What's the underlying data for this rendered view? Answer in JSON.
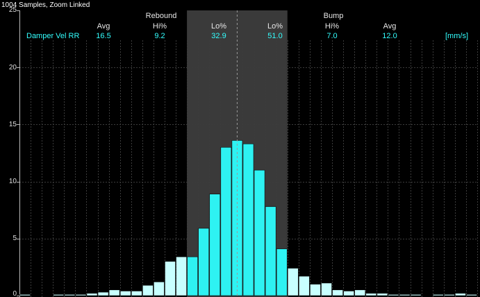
{
  "header": {
    "title": "1004 Samples, Zoom Linked",
    "rebound_label": "Rebound",
    "bump_label": "Bump",
    "columns": [
      "Avg",
      "Hi%",
      "Lo%",
      "Lo%",
      "Hi%",
      "Avg"
    ],
    "series_name": "Damper Vel RR",
    "values": [
      "16.5",
      "9.2",
      "32.9",
      "51.0",
      "7.0",
      "12.0"
    ],
    "unit": "[mm/s]"
  },
  "colors": {
    "background": "#000000",
    "low_band": "#3a3a3a",
    "bar_low": "#2ef2f2",
    "bar_high": "#c8ffff",
    "grid": "#3c3c3c",
    "zero_line": "#9a9a9a",
    "text": "#e8e8e8",
    "accent": "#33ffff"
  },
  "chart_data": {
    "type": "bar",
    "title": "",
    "xlabel": "",
    "ylabel": "",
    "ylim": [
      0,
      25
    ],
    "yticks": [
      "0",
      "5",
      "10",
      "15",
      "20",
      "25"
    ],
    "grid": true,
    "values": [
      0.1,
      0.0,
      0.0,
      0.1,
      0.1,
      0.1,
      0.2,
      0.3,
      0.5,
      0.4,
      0.4,
      0.9,
      1.2,
      3.0,
      3.4,
      3.4,
      5.9,
      8.9,
      13.0,
      13.6,
      13.3,
      11.0,
      7.8,
      4.1,
      2.4,
      1.7,
      1.0,
      1.1,
      0.5,
      0.4,
      0.5,
      0.2,
      0.2,
      0.1,
      0.1,
      0.1,
      0.0,
      0.1,
      0.1,
      0.2,
      0.1
    ],
    "low_speed_band_bins": [
      15,
      24
    ]
  }
}
